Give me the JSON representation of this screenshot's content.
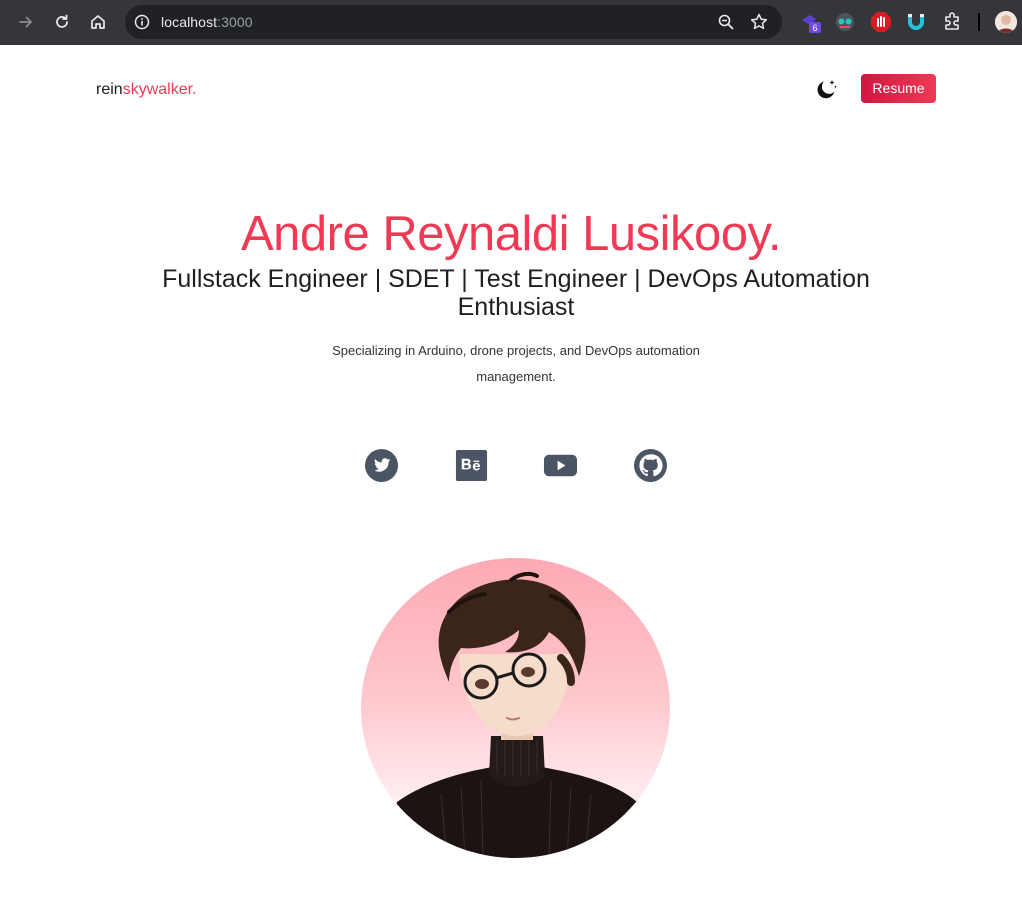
{
  "browser": {
    "url_host": "localhost",
    "url_port": ":3000",
    "extension_badge": "6"
  },
  "header": {
    "logo_part1": "rein",
    "logo_part2": "skywalker.",
    "resume_label": "Resume"
  },
  "hero": {
    "name": "Andre Reynaldi Lusikooy.",
    "roles": "Fullstack Engineer | SDET | Test Engineer | DevOps Automation Enthusiast",
    "description": "Specializing in Arduino, drone projects, and DevOps automation management."
  },
  "social": [
    {
      "icon": "twitter-icon"
    },
    {
      "icon": "behance-icon"
    },
    {
      "icon": "youtube-icon"
    },
    {
      "icon": "github-icon"
    }
  ],
  "colors": {
    "accent": "#ef3a56",
    "accent_dark": "#d01741",
    "icon_gray": "#4b5563",
    "chrome_bg": "#35363a",
    "omnibox_bg": "#202124"
  }
}
